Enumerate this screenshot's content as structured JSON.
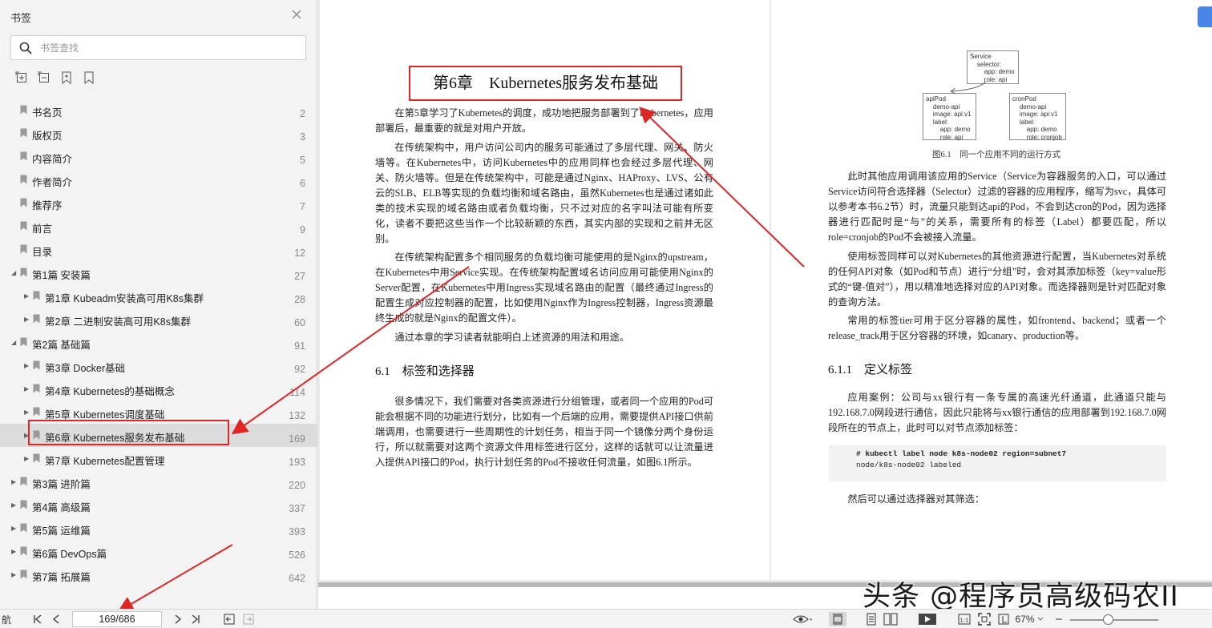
{
  "sidebar": {
    "title": "书签",
    "search_placeholder": "书签查找",
    "items": [
      {
        "label": "书名页",
        "page": "2",
        "level": 0,
        "toggle": ""
      },
      {
        "label": "版权页",
        "page": "3",
        "level": 0,
        "toggle": ""
      },
      {
        "label": "内容简介",
        "page": "5",
        "level": 0,
        "toggle": ""
      },
      {
        "label": "作者简介",
        "page": "6",
        "level": 0,
        "toggle": ""
      },
      {
        "label": "推荐序",
        "page": "7",
        "level": 0,
        "toggle": ""
      },
      {
        "label": "前言",
        "page": "9",
        "level": 0,
        "toggle": ""
      },
      {
        "label": "目录",
        "page": "12",
        "level": 0,
        "toggle": ""
      },
      {
        "label": "第1篇 安装篇",
        "page": "27",
        "level": 0,
        "toggle": "expanded"
      },
      {
        "label": "第1章 Kubeadm安装高可用K8s集群",
        "page": "28",
        "level": 1,
        "toggle": "collapsed"
      },
      {
        "label": "第2章 二进制安装高可用K8s集群",
        "page": "60",
        "level": 1,
        "toggle": "collapsed"
      },
      {
        "label": "第2篇 基础篇",
        "page": "91",
        "level": 0,
        "toggle": "expanded"
      },
      {
        "label": "第3章 Docker基础",
        "page": "92",
        "level": 1,
        "toggle": "collapsed"
      },
      {
        "label": "第4章 Kubernetes的基础概念",
        "page": "114",
        "level": 1,
        "toggle": "collapsed"
      },
      {
        "label": "第5章 Kubernetes调度基础",
        "page": "132",
        "level": 1,
        "toggle": "collapsed"
      },
      {
        "label": "第6章 Kubernetes服务发布基础",
        "page": "169",
        "level": 1,
        "toggle": "collapsed",
        "selected": true
      },
      {
        "label": "第7章 Kubernetes配置管理",
        "page": "193",
        "level": 1,
        "toggle": "collapsed"
      },
      {
        "label": "第3篇 进阶篇",
        "page": "220",
        "level": 0,
        "toggle": "collapsed"
      },
      {
        "label": "第4篇 高级篇",
        "page": "337",
        "level": 0,
        "toggle": "collapsed"
      },
      {
        "label": "第5篇 运维篇",
        "page": "393",
        "level": 0,
        "toggle": "collapsed"
      },
      {
        "label": "第6篇 DevOps篇",
        "page": "526",
        "level": 0,
        "toggle": "collapsed"
      },
      {
        "label": "第7篇 拓展篇",
        "page": "642",
        "level": 0,
        "toggle": "collapsed"
      }
    ]
  },
  "page_left": {
    "chapter_title": "第6章　Kubernetes服务发布基础",
    "p1": "在第5章学习了Kubernetes的调度，成功地把服务部署到了Kubernetes，应用部署后，最重要的就是对用户开放。",
    "p2": "在传统架构中，用户访问公司内的服务可能通过了多层代理、网关、防火墙等。在Kubernetes中，访问Kubernetes中的应用同样也会经过多层代理、网关、防火墙等。但是在传统架构中，可能是通过Nginx、HAProxy、LVS、公有云的SLB、ELB等实现的负载均衡和域名路由，虽然Kubernetes也是通过诸如此类的技术实现的域名路由或者负载均衡，只不过对应的名字叫法可能有所变化，读者不要把这些当作一个比较新颖的东西，其实内部的实现和之前并无区别。",
    "p3": "在传统架构配置多个相同服务的负载均衡可能使用的是Nginx的upstream，在Kubernetes中用Service实现。在传统架构配置域名访问应用可能使用Nginx的Server配置，在Kubernetes中用Ingress实现域名路由的配置（最终通过Ingress的配置生成对应控制器的配置，比如使用Nginx作为Ingress控制器，Ingress资源最终生成的就是Nginx的配置文件）。",
    "p4": "通过本章的学习读者就能明白上述资源的用法和用途。",
    "section": "6.1　标签和选择器",
    "p5": "很多情况下，我们需要对各类资源进行分组管理，或者同一个应用的Pod可能会根据不同的功能进行划分，比如有一个后端的应用，需要提供API接口供前端调用，也需要进行一些周期性的计划任务，相当于同一个镜像分两个身份运行，所以就需要对这两个资源文件用标签进行区分，这样的话就可以让流量进入提供API接口的Pod，执行计划任务的Pod不接收任何流量，如图6.1所示。"
  },
  "page_right": {
    "figure": {
      "service_box": "Service\n    selector:\n        app: demo\n        role: api",
      "apipod_box": "apiPod\n    demo-api\n    image: api:v1\n    label:\n        app: demo\n        role: api",
      "cronpod_box": "cronPod\n    demo-api\n    image: api:v1\n    label:\n        app: demo\n        role: cronjob",
      "caption": "图6.1　同一个应用不同的运行方式"
    },
    "p1": "此时其他应用调用该应用的Service（Service为容器服务的入口，可以通过Service访问符合选择器（Selector）过滤的容器的应用程序，缩写为svc，具体可以参考本书6.2节）时，流量只能到达api的Pod，不会到达cron的Pod，因为选择器进行匹配时是“与”的关系，需要所有的标签（Label）都要匹配，所以role=cronjob的Pod不会被接入流量。",
    "p2": "使用标签同样可以对Kubernetes的其他资源进行配置，当Kubernetes对系统的任何API对象（如Pod和节点）进行“分组”时，会对其添加标签（key=value形式的“键-值对”），用以精准地选择对应的API对象。而选择器则是针对匹配对象的查询方法。",
    "p3": "常用的标签tier可用于区分容器的属性，如frontend、backend；或者一个release_track用于区分容器的环境，如canary、production等。",
    "section": "6.1.1　定义标签",
    "p4": "应用案例：公司与xx银行有一条专属的高速光纤通道，此通道只能与192.168.7.0网段进行通信，因此只能将与xx银行通信的应用部署到192.168.7.0网段所在的节点上，此时可以对节点添加标签：",
    "code_line1": "# kubectl label node k8s-node02 region=subnet7",
    "code_line2": "node/k8s-node02 labeled",
    "p5": "然后可以通过选择器对其筛选："
  },
  "watermark": "头条 @程序员高级码农II",
  "bottombar": {
    "nav_label": "航",
    "page_value": "169/686",
    "zoom": "67%"
  },
  "colors": {
    "accent_red": "#e02525",
    "sidebar_bg": "#f3f3f3",
    "selected_bg": "#dcdcdc"
  }
}
